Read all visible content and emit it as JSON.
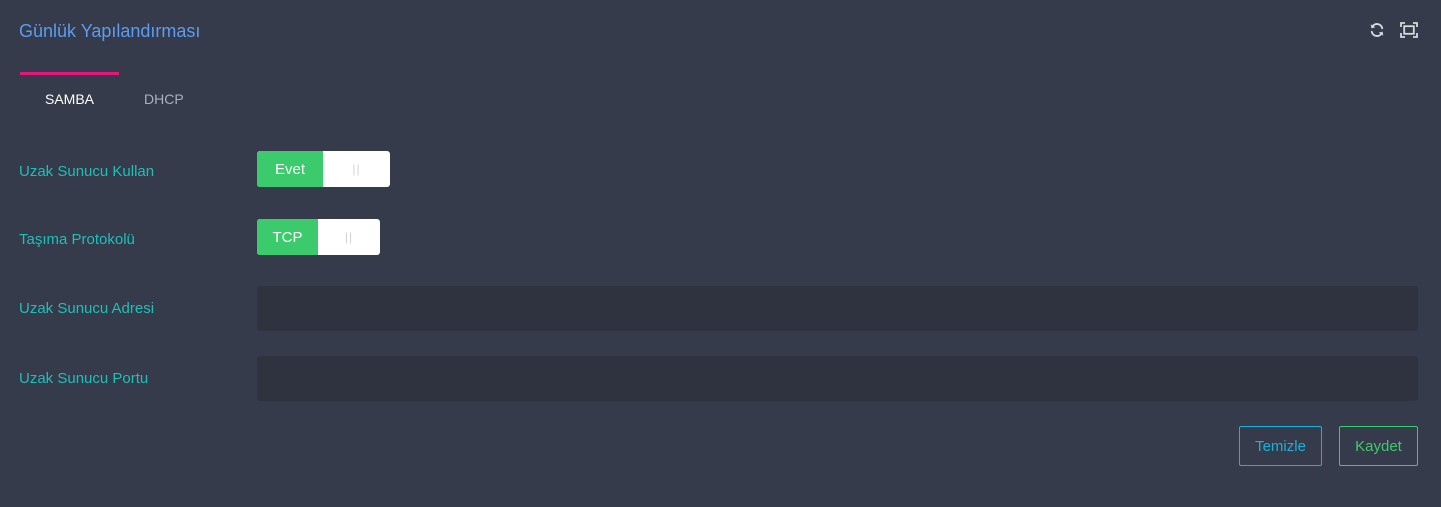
{
  "panel": {
    "title": "Günlük Yapılandırması",
    "tools": [
      {
        "icon": "refresh-icon"
      },
      {
        "icon": "fullscreen-icon"
      }
    ]
  },
  "tabs": [
    {
      "label": "SAMBA",
      "active": true
    },
    {
      "label": "DHCP",
      "active": false
    }
  ],
  "form": {
    "use_remote_server": {
      "label": "Uzak Sunucu Kullan",
      "value": "Evet",
      "handle": "||"
    },
    "transport_protocol": {
      "label": "Taşıma Protokolü",
      "value": "TCP",
      "handle": "||"
    },
    "remote_server_address": {
      "label": "Uzak Sunucu Adresi",
      "value": "",
      "placeholder": ""
    },
    "remote_server_port": {
      "label": "Uzak Sunucu Portu",
      "value": "",
      "placeholder": ""
    }
  },
  "actions": {
    "clear_label": "Temizle",
    "save_label": "Kaydet"
  },
  "colors": {
    "background": "#353b4a",
    "title": "#5b9cf2",
    "label": "#1fbfb8",
    "active_tab_indicator": "#e6177a",
    "switch_on": "#3ccb6c",
    "input_bg": "#2e333f",
    "clear_button": "#1ab0d8",
    "save_button": "#3ccb6c"
  }
}
